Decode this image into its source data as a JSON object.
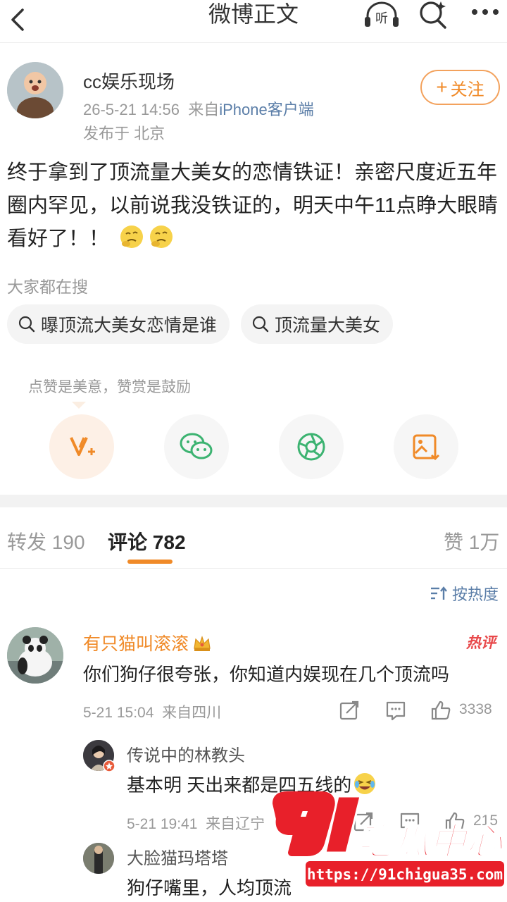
{
  "nav": {
    "title": "微博正文",
    "listen_label": "听"
  },
  "post": {
    "author": "cc娱乐现场",
    "datetime": "26-5-21 14:56",
    "source_prefix": "来自",
    "source": "iPhone客户端",
    "location": "发布于 北京",
    "follow_label": "关注",
    "text": "终于拿到了顶流量大美女的恋情铁证！亲密尺度近五年圈内罕见，以前说我没铁证的，明天中午11点睁大眼睛看好了！！"
  },
  "search": {
    "heading": "大家都在搜",
    "chips": [
      "曝顶流大美女恋情是谁",
      "顶流量大美女"
    ]
  },
  "reward": {
    "tip": "点赞是美意，赞赏是鼓励"
  },
  "tabs": {
    "repost_label": "转发",
    "repost_count": "190",
    "comment_label": "评论",
    "comment_count": "782",
    "like_label": "赞",
    "like_count": "1万"
  },
  "sort": {
    "label": "按热度"
  },
  "comment": {
    "name": "有只猫叫滚滚",
    "hot_badge": "热评",
    "text": "你们狗仔很夸张，你知道内娱现在几个顶流吗",
    "time": "5-21 15:04",
    "location": "来自四川",
    "likes": "3338"
  },
  "replies": [
    {
      "name": "传说中的林教头",
      "text": "基本明 天出来都是四五线的",
      "time": "5-21 19:41",
      "location": "来自辽宁",
      "likes": "215"
    },
    {
      "name": "大脸猫玛塔塔",
      "text": "狗仔嘴里，人均顶流"
    }
  ],
  "watermark": {
    "logo_text": "91吃瓜中心",
    "url": "https://91chigua35.com"
  },
  "colors": {
    "accent": "#f08a28",
    "link": "#5b7ea8",
    "hot": "#e8484a"
  }
}
